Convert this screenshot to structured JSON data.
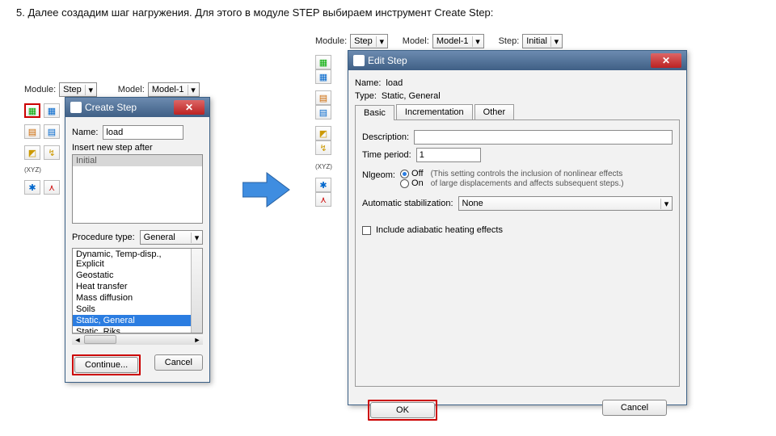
{
  "caption": "5. Далее создадим шаг нагружения. Для этого в модуле STEP выбираем инструмент Create Step:",
  "left_ctx": {
    "module_label": "Module:",
    "module_value": "Step",
    "model_label": "Model:",
    "model_value": "Model-1"
  },
  "right_ctx": {
    "module_label": "Module:",
    "module_value": "Step",
    "model_label": "Model:",
    "model_value": "Model-1",
    "step_label": "Step:",
    "step_value": "Initial"
  },
  "xyz_label": "(XYZ)",
  "create_step": {
    "title": "Create Step",
    "name_label": "Name:",
    "name_value": "load",
    "insert_label": "Insert new step after",
    "insert_items": [
      "Initial"
    ],
    "proc_label": "Procedure type:",
    "proc_value": "General",
    "proc_items": [
      "Dynamic, Temp-disp., Explicit",
      "Geostatic",
      "Heat transfer",
      "Mass diffusion",
      "Soils",
      "Static, General",
      "Static, Riks"
    ],
    "proc_selected_index": 5,
    "continue_btn": "Continue...",
    "cancel_btn": "Cancel"
  },
  "edit_step": {
    "title": "Edit Step",
    "name_label": "Name:",
    "name_value": "load",
    "type_label": "Type:",
    "type_value": "Static, General",
    "tabs": [
      "Basic",
      "Incrementation",
      "Other"
    ],
    "desc_label": "Description:",
    "desc_value": "",
    "time_label": "Time period:",
    "time_value": "1",
    "nlgeom_label": "Nlgeom:",
    "nlgeom_off": "Off",
    "nlgeom_on": "On",
    "nlgeom_note1": "(This setting controls the inclusion of nonlinear effects",
    "nlgeom_note2": "of large displacements and affects subsequent steps.)",
    "stab_label": "Automatic stabilization:",
    "stab_value": "None",
    "adiabatic_label": "Include adiabatic heating effects",
    "ok_btn": "OK",
    "cancel_btn": "Cancel"
  }
}
